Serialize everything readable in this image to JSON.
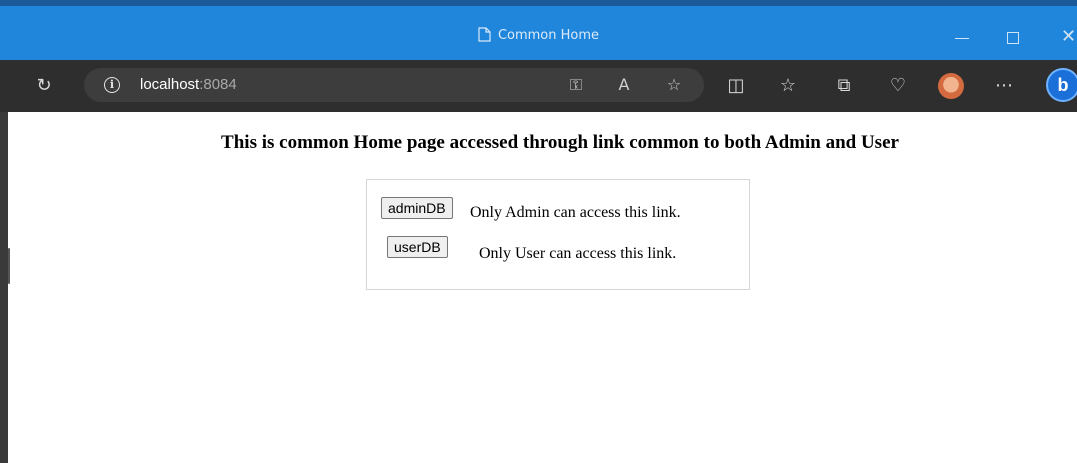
{
  "window": {
    "title": "Common Home"
  },
  "toolbar": {
    "url_host": "localhost",
    "url_port": ":8084"
  },
  "page": {
    "heading": "This is common Home page accessed through link common to both Admin and User",
    "links": [
      {
        "button_label": "adminDB",
        "description": "Only Admin can access this link."
      },
      {
        "button_label": "userDB",
        "description": "Only User can access this link."
      }
    ]
  }
}
